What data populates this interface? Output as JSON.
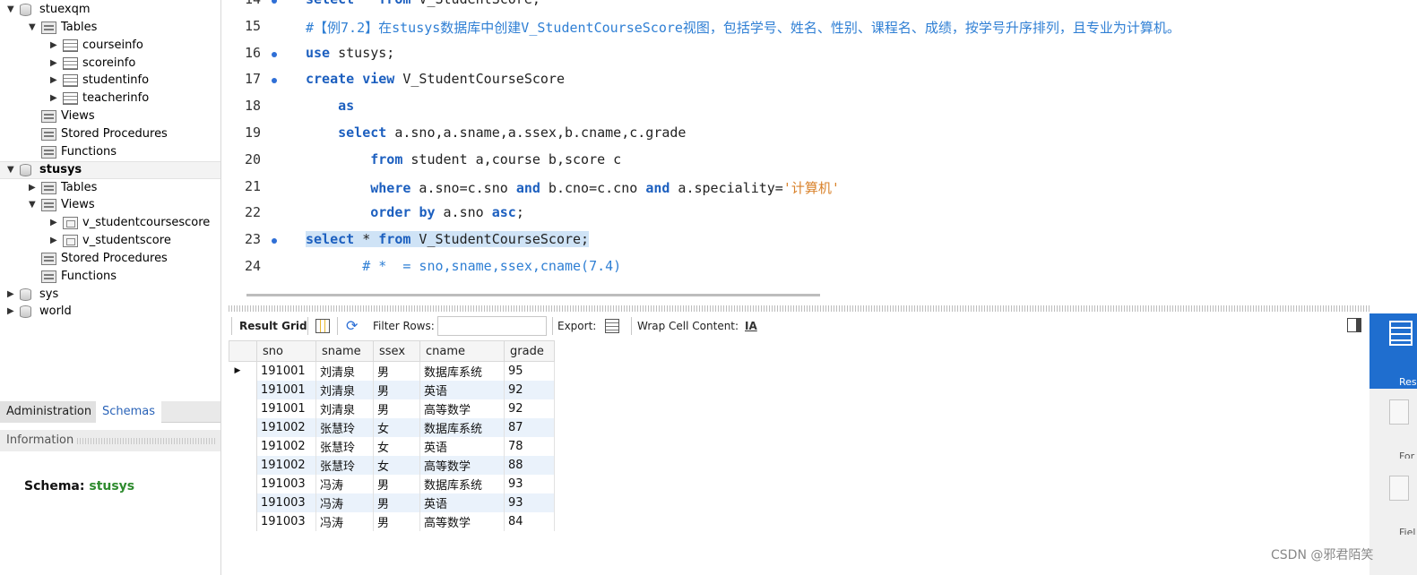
{
  "navigator": {
    "tree": [
      {
        "label": "stuexqm",
        "bold": false,
        "indent": 0,
        "arrow": "▼",
        "icon": "database"
      },
      {
        "label": "Tables",
        "bold": false,
        "indent": 1,
        "arrow": "▼",
        "icon": "folder"
      },
      {
        "label": "courseinfo",
        "bold": false,
        "indent": 2,
        "arrow": "▶",
        "icon": "table"
      },
      {
        "label": "scoreinfo",
        "bold": false,
        "indent": 2,
        "arrow": "▶",
        "icon": "table"
      },
      {
        "label": "studentinfo",
        "bold": false,
        "indent": 2,
        "arrow": "▶",
        "icon": "table"
      },
      {
        "label": "teacherinfo",
        "bold": false,
        "indent": 2,
        "arrow": "▶",
        "icon": "table"
      },
      {
        "label": "Views",
        "bold": false,
        "indent": 1,
        "arrow": "",
        "icon": "folder"
      },
      {
        "label": "Stored Procedures",
        "bold": false,
        "indent": 1,
        "arrow": "",
        "icon": "folder"
      },
      {
        "label": "Functions",
        "bold": false,
        "indent": 1,
        "arrow": "",
        "icon": "folder"
      },
      {
        "label": "stusys",
        "bold": true,
        "indent": 0,
        "arrow": "▼",
        "icon": "database"
      },
      {
        "label": "Tables",
        "bold": false,
        "indent": 1,
        "arrow": "▶",
        "icon": "folder"
      },
      {
        "label": "Views",
        "bold": false,
        "indent": 1,
        "arrow": "▼",
        "icon": "folder"
      },
      {
        "label": "v_studentcoursescore",
        "bold": false,
        "indent": 2,
        "arrow": "▶",
        "icon": "view"
      },
      {
        "label": "v_studentscore",
        "bold": false,
        "indent": 2,
        "arrow": "▶",
        "icon": "view"
      },
      {
        "label": "Stored Procedures",
        "bold": false,
        "indent": 1,
        "arrow": "",
        "icon": "folder"
      },
      {
        "label": "Functions",
        "bold": false,
        "indent": 1,
        "arrow": "",
        "icon": "folder"
      },
      {
        "label": "sys",
        "bold": false,
        "indent": 0,
        "arrow": "▶",
        "icon": "database"
      },
      {
        "label": "world",
        "bold": false,
        "indent": 0,
        "arrow": "▶",
        "icon": "database"
      }
    ],
    "tabs": {
      "administration": "Administration",
      "schemas": "Schemas"
    },
    "information_label": "Information",
    "schema_label": "Schema:",
    "schema_value": "stusys"
  },
  "editor": {
    "lines": [
      {
        "num": "14",
        "dot": true,
        "html": "<span class='kw'>select</span> * <span class='kw'>from</span> V_StudentScore;"
      },
      {
        "num": "15",
        "dot": false,
        "html": "<span class='cm'>#【例7.2】在stusys数据库中创建V_StudentCourseScore视图，包括学号、姓名、性别、课程名、成绩，按学号升序排列，且专业为计算机。</span>"
      },
      {
        "num": "16",
        "dot": true,
        "html": "<span class='kw'>use</span> stusys;"
      },
      {
        "num": "17",
        "dot": true,
        "html": "<span class='kw'>create</span> <span class='kw'>view</span> V_StudentCourseScore"
      },
      {
        "num": "18",
        "dot": false,
        "html": "    <span class='kw'>as</span>"
      },
      {
        "num": "19",
        "dot": false,
        "html": "    <span class='kw'>select</span> a.sno,a.sname,a.ssex,b.cname,c.grade"
      },
      {
        "num": "20",
        "dot": false,
        "html": "        <span class='kw'>from</span> student a,course b,score c"
      },
      {
        "num": "21",
        "dot": false,
        "html": "        <span class='kw'>where</span> a.sno=c.sno <span class='kw'>and</span> b.cno=c.cno <span class='kw'>and</span> a.speciality=<span class='str'>'计算机'</span>"
      },
      {
        "num": "22",
        "dot": false,
        "html": "        <span class='kw'>order</span> <span class='kw'>by</span> a.sno <span class='kw'>asc</span>;"
      },
      {
        "num": "23",
        "dot": true,
        "html": "<span class='hl'><span class='kw'>select</span> * <span class='kw'>from</span> V_StudentCourseScore;</span>"
      },
      {
        "num": "24",
        "dot": false,
        "html": "       <span class='cm'># *  = sno,sname,ssex,cname(7.4)</span>"
      }
    ]
  },
  "result": {
    "toolbar": {
      "result_grid": "Result Grid",
      "filter_rows": "Filter Rows:",
      "filter_value": "",
      "export": "Export:",
      "wrap": "Wrap Cell Content:"
    },
    "columns": [
      "sno",
      "sname",
      "ssex",
      "cname",
      "grade"
    ],
    "rows": [
      [
        "191001",
        "刘清泉",
        "男",
        "数据库系统",
        "95"
      ],
      [
        "191001",
        "刘清泉",
        "男",
        "英语",
        "92"
      ],
      [
        "191001",
        "刘清泉",
        "男",
        "高等数学",
        "92"
      ],
      [
        "191002",
        "张慧玲",
        "女",
        "数据库系统",
        "87"
      ],
      [
        "191002",
        "张慧玲",
        "女",
        "英语",
        "78"
      ],
      [
        "191002",
        "张慧玲",
        "女",
        "高等数学",
        "88"
      ],
      [
        "191003",
        "冯涛",
        "男",
        "数据库系统",
        "93"
      ],
      [
        "191003",
        "冯涛",
        "男",
        "英语",
        "93"
      ],
      [
        "191003",
        "冯涛",
        "男",
        "高等数学",
        "84"
      ]
    ]
  },
  "side": {
    "result_grid": "Resu\nGri",
    "form_editor": "For\nEdit",
    "field_types": "Fiel\nTyp"
  },
  "watermark": "CSDN @邪君陌笑"
}
